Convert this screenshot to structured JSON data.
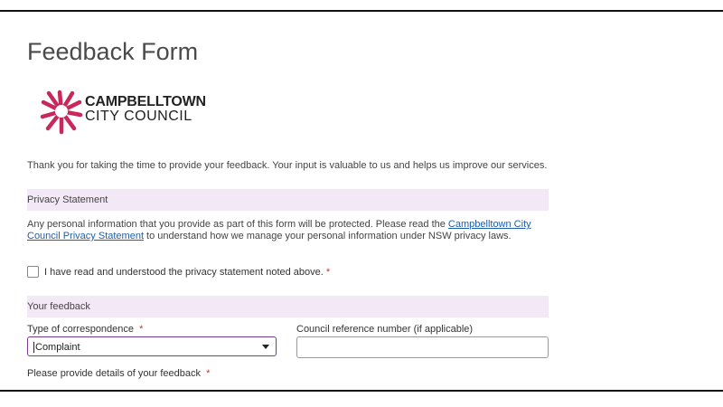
{
  "page": {
    "title": "Feedback Form"
  },
  "logo": {
    "line1": "CAMPBELLTOWN",
    "line2": "CITY COUNCIL",
    "accent_color": "#c8285a"
  },
  "intro": {
    "text": "Thank you for taking the time to provide your feedback. Your input is valuable to us and helps us improve our services."
  },
  "privacy": {
    "section_title": "Privacy Statement",
    "text_before_link": "Any personal information that you provide as part of this form will be protected. Please read the ",
    "link_text": "Campbelltown City Council Privacy Statement",
    "text_after_link": " to understand how we manage your personal information under NSW privacy laws.",
    "checkbox_label": "I have read and understood the privacy statement noted above.",
    "required_marker": "*"
  },
  "feedback": {
    "section_title": "Your feedback",
    "type_label": "Type of correspondence",
    "type_required": "*",
    "type_value": "Complaint",
    "reference_label": "Council reference number (if applicable)",
    "reference_value": "",
    "details_label": "Please provide details of your feedback",
    "details_required": "*"
  },
  "colors": {
    "section_bg": "#f3e8f6",
    "link": "#1f5ea8",
    "required": "#c0392b",
    "select_border": "#7a3a8a"
  }
}
